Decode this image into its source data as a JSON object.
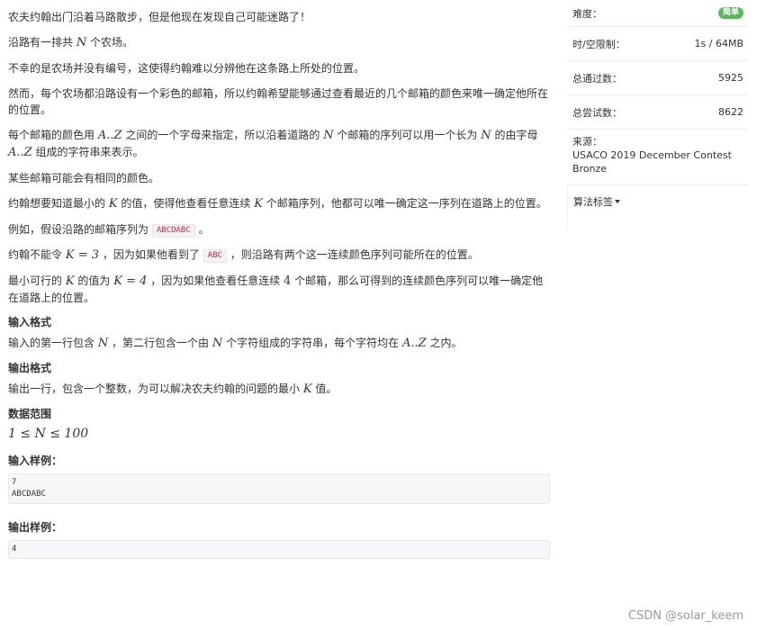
{
  "problem": {
    "p1": "农夫约翰出门沿着马路散步，但是他现在发现自己可能迷路了！",
    "p2_pre": "沿路有一排共",
    "p2_N": "N",
    "p2_post": "个农场。",
    "p3": "不幸的是农场并没有编号，这使得约翰难以分辨他在这条路上所处的位置。",
    "p4": "然而，每个农场都沿路设有一个彩色的邮箱，所以约翰希望能够通过查看最近的几个邮箱的颜色来唯一确定他所在的位置。",
    "p5_a": "每个邮箱的颜色用",
    "p5_range1": "A..Z",
    "p5_b": "之间的一个字母来指定，所以沿着道路的",
    "p5_N1": "N",
    "p5_c": "个邮箱的序列可以用一个长为",
    "p5_N2": "N",
    "p5_d": "的由字母",
    "p5_range2": "A..Z",
    "p5_e": "组成的字符串来表示。",
    "p6": "某些邮箱可能会有相同的颜色。",
    "p7_a": "约翰想要知道最小的",
    "p7_K1": "K",
    "p7_b": "的值，使得他查看任意连续",
    "p7_K2": "K",
    "p7_c": "个邮箱序列，他都可以唯一确定这一序列在道路上的位置。",
    "p8_a": "例如，假设沿路的邮箱序列为",
    "p8_code": "ABCDABC",
    "p8_b": "。",
    "p9_a": "约翰不能令",
    "p9_eq": "K = 3",
    "p9_b": "，因为如果他看到了",
    "p9_code": "ABC",
    "p9_c": "，则沿路有两个这一连续颜色序列可能所在的位置。",
    "p10_a": "最小可行的",
    "p10_K": "K",
    "p10_b": "的值为",
    "p10_eq": "K = 4",
    "p10_c": "，因为如果他查看任意连续",
    "p10_4": "4",
    "p10_d": "个邮箱，那么可得到的连续颜色序列可以唯一确定他在道路上的位置。"
  },
  "input_format": {
    "heading": "输入格式",
    "a": "输入的第一行包含",
    "N": "N",
    "b": "，第二行包含一个由",
    "N2": "N",
    "c": "个字符组成的字符串，每个字符均在",
    "range": "A..Z",
    "d": "之内。"
  },
  "output_format": {
    "heading": "输出格式",
    "a": "输出一行，包含一个整数，为可以解决农夫约翰的问题的最小",
    "K": "K",
    "b": "值。"
  },
  "data_range": {
    "heading": "数据范围",
    "expr": "1 ≤ N ≤ 100"
  },
  "sample_input": {
    "heading": "输入样例：",
    "line1": "7",
    "line2": "ABCDABC"
  },
  "sample_output": {
    "heading": "输出样例：",
    "line1": "4"
  },
  "sidebar": {
    "difficulty_label": "难度：",
    "difficulty_value": "简单",
    "limit_label": "时/空限制：",
    "limit_value": "1s / 64MB",
    "accepted_label": "总通过数：",
    "accepted_value": "5925",
    "attempts_label": "总尝试数：",
    "attempts_value": "8622",
    "source_label": "来源：",
    "source_value": "USACO 2019 December Contest Bronze",
    "tags_label": "算法标签"
  },
  "watermark": "CSDN @solar_keem",
  "colors": {
    "badge": "#5cb85c",
    "code_text": "#c7254e",
    "code_bg": "#f9f2f4"
  }
}
